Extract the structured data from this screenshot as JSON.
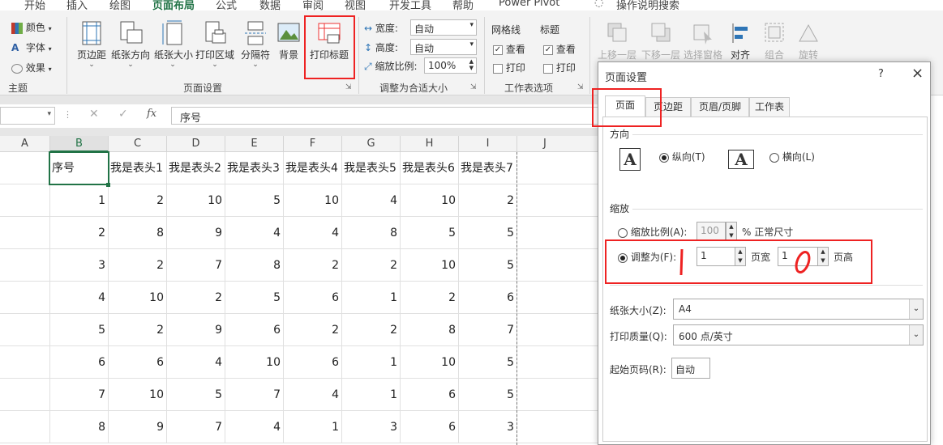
{
  "tabs": [
    "开始",
    "插入",
    "绘图",
    "页面布局",
    "公式",
    "数据",
    "审阅",
    "视图",
    "开发工具",
    "帮助",
    "Power Pivot",
    "操作说明搜索"
  ],
  "theme": {
    "colors": "颜色",
    "fonts": "字体",
    "effects": "效果",
    "label": "主题"
  },
  "page_setup_group": {
    "margins": "页边距",
    "orientation": "纸张方向",
    "size": "纸张大小",
    "print_area": "打印区域",
    "breaks": "分隔符",
    "background": "背景",
    "print_titles": "打印标题",
    "label": "页面设置"
  },
  "scale_group": {
    "width_label": "宽度:",
    "width_value": "自动",
    "height_label": "高度:",
    "height_value": "自动",
    "scale_label": "缩放比例:",
    "scale_value": "100%",
    "label": "调整为合适大小"
  },
  "sheet_options": {
    "gridlines": "网格线",
    "headings": "标题",
    "view": "查看",
    "print": "打印",
    "label": "工作表选项"
  },
  "arrange": {
    "bring_forward": "上移一层",
    "send_backward": "下移一层",
    "selection_pane": "选择窗格",
    "align": "对齐",
    "group": "组合",
    "rotate": "旋转"
  },
  "formula_bar": {
    "name_box": "",
    "fx": "fx",
    "content": "序号"
  },
  "columns": [
    "A",
    "B",
    "C",
    "D",
    "E",
    "F",
    "G",
    "H",
    "I",
    "J"
  ],
  "rows": [
    [
      "",
      "序号",
      "我是表头1",
      "我是表头2",
      "我是表头3",
      "我是表头4",
      "我是表头5",
      "我是表头6",
      "我是表头7"
    ],
    [
      "",
      "1",
      "2",
      "10",
      "5",
      "10",
      "4",
      "10",
      "2"
    ],
    [
      "",
      "2",
      "8",
      "9",
      "4",
      "4",
      "8",
      "5",
      "5"
    ],
    [
      "",
      "3",
      "2",
      "7",
      "8",
      "2",
      "2",
      "10",
      "5"
    ],
    [
      "",
      "4",
      "10",
      "2",
      "5",
      "6",
      "1",
      "2",
      "6"
    ],
    [
      "",
      "5",
      "2",
      "9",
      "6",
      "2",
      "2",
      "8",
      "7"
    ],
    [
      "",
      "6",
      "6",
      "4",
      "10",
      "6",
      "1",
      "10",
      "5"
    ],
    [
      "",
      "7",
      "10",
      "5",
      "7",
      "4",
      "1",
      "6",
      "5"
    ],
    [
      "",
      "8",
      "9",
      "7",
      "4",
      "1",
      "3",
      "6",
      "3"
    ]
  ],
  "dialog": {
    "title": "页面设置",
    "help": "?",
    "close": "×",
    "tabs": [
      "页面",
      "页边距",
      "页眉/页脚",
      "工作表"
    ],
    "orientation_label": "方向",
    "portrait": "纵向(T)",
    "landscape": "横向(L)",
    "scaling_label": "缩放",
    "adjust_to": "缩放比例(A):",
    "adjust_value": "100",
    "percent_label": "% 正常尺寸",
    "fit_to": "调整为(F):",
    "fit_wide": "1",
    "wide_label": "页宽",
    "fit_tall": "1",
    "tall_label": "页高",
    "paper_size_label": "纸张大小(Z):",
    "paper_size": "A4",
    "print_quality_label": "打印质量(Q):",
    "print_quality": "600 点/英寸",
    "first_page_label": "起始页码(R):",
    "first_page": "自动"
  },
  "colors": {
    "accent": "#217346",
    "highlight": "#ee2222"
  }
}
